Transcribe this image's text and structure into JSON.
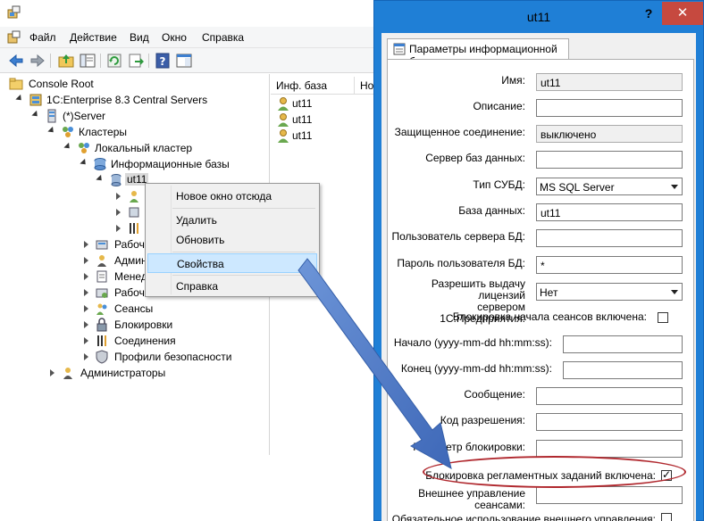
{
  "menu": [
    "Файл",
    "Действие",
    "Вид",
    "Окно",
    "Справка"
  ],
  "toolbar_icons": [
    "back-arrow-icon",
    "forward-arrow-icon",
    "up-folder-icon",
    "show-tree-icon",
    "refresh-icon",
    "export-icon",
    "help-icon",
    "properties-pane-icon"
  ],
  "tree": {
    "root": "Console Root",
    "servers": "1C:Enterprise 8.3 Central Servers",
    "server": "(*)Server",
    "clusters": "Кластеры",
    "local_cluster": "Локальный кластер",
    "infobases": "Информационные базы",
    "ut11": "ut11",
    "working_processes_short": "Рабоч",
    "admins_short": "Админ",
    "managers_short": "Менед",
    "working_servers_short": "Рабоч",
    "sessions": "Сеансы",
    "locks": "Блокировки",
    "connections": "Соединения",
    "security_profiles": "Профили безопасности",
    "administrators": "Администраторы"
  },
  "list": {
    "col1": "Инф. база",
    "col2": "Но",
    "rows": [
      "ut11",
      "ut11",
      "ut11"
    ]
  },
  "context_menu": {
    "new_window": "Новое окно отсюда",
    "delete": "Удалить",
    "refresh": "Обновить",
    "properties": "Свойства",
    "help": "Справка"
  },
  "dialog": {
    "title": "ut11",
    "help": "?",
    "close": "✕",
    "tab": "Параметры информационной базы",
    "fields": {
      "name_label": "Имя:",
      "name_value": "ut11",
      "desc_label": "Описание:",
      "desc_value": "",
      "secure_label": "Защищенное соединение:",
      "secure_value": "выключено",
      "dbserver_label": "Сервер баз данных:",
      "dbserver_value": "",
      "dbms_label": "Тип СУБД:",
      "dbms_value": "MS SQL Server",
      "db_label": "База данных:",
      "db_value": "ut11",
      "dbuser_label": "Пользователь сервера БД:",
      "dbuser_value": "",
      "dbpass_label": "Пароль пользователя БД:",
      "dbpass_value": "*",
      "license_label_1": "Разрешить выдачу лицензий",
      "license_label_2": "сервером 1С:Предприятия:",
      "license_value": "Нет",
      "session_lock_label": "Блокировка начала сеансов включена:",
      "start_label": "Начало (yyyy-mm-dd hh:mm:ss):",
      "end_label": "Конец (yyyy-mm-dd hh:mm:ss):",
      "message_label": "Сообщение:",
      "permission_label": "Код разрешения:",
      "lock_param_label": "Параметр блокировки:",
      "sched_jobs_label": "Блокировка регламентных заданий включена:",
      "ext_mgmt_label_1": "Внешнее управление",
      "ext_mgmt_label_2": "сеансами:",
      "ext_mgmt_required_label": "Обязательное использование внешнего управления:"
    },
    "session_lock_checked": false,
    "sched_jobs_checked": true,
    "ext_mgmt_required_checked": false
  },
  "colors": {
    "dialog_border": "#1f7fd6",
    "close_button": "#c6493f",
    "highlight": "#cde8ff",
    "arrow": "#4a78c8",
    "ellipse": "#b0282e"
  }
}
